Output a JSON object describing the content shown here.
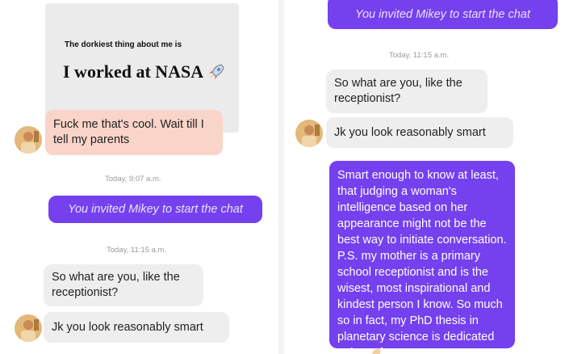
{
  "left": {
    "prompt_question": "The dorkiest thing about me is",
    "prompt_answer": "I worked at NASA",
    "prompt_emoji": "rocket-icon",
    "reply_1": "Fuck me that's cool. Wait till I tell my parents",
    "timestamp_1": "Today, 9:07 a.m.",
    "system_msg": "You invited Mikey to start the chat",
    "timestamp_2": "Today, 11:15 a.m.",
    "msg_1": "So what are you, like the receptionist?",
    "msg_2": "Jk you look reasonably smart"
  },
  "right": {
    "system_msg": "You invited Mikey to start the chat",
    "timestamp": "Today, 11:15 a.m.",
    "msg_1": "So what are you, like the receptionist?",
    "msg_2": "Jk you look reasonably smart",
    "reply": "Smart enough to know at least, that judging a woman's intelligence based on her appearance might not be the best way to initiate conversation. P.S. my mother is a primary school receptionist and is the wisest, most inspirational and kindest person I know. So much so in fact, my PhD thesis in planetary science is dedicated to her",
    "reply_emoji": "waving-hand-icon"
  },
  "colors": {
    "accent_purple": "#7540ee",
    "bubble_grey": "#eeeeee",
    "bubble_peach": "#f9d4c8"
  }
}
